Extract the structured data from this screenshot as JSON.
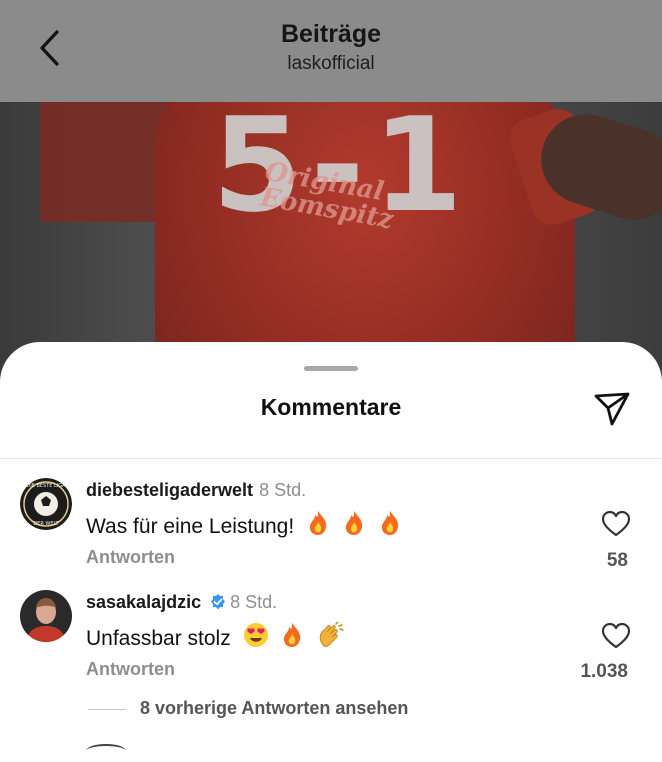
{
  "header": {
    "title": "Beiträge",
    "subtitle": "laskofficial"
  },
  "post": {
    "score_text": "5-1",
    "sponsor_text": "Original\nEomspitz"
  },
  "sheet": {
    "title": "Kommentare"
  },
  "comments": [
    {
      "username": "diebesteligaderwelt",
      "time": "8 Std.",
      "text": "Was für eine Leistung!",
      "emojis": [
        "fire",
        "fire",
        "fire"
      ],
      "reply_label": "Antworten",
      "likes": "58",
      "verified": false,
      "avatar_logo_text": "DIE BESTE LIGA DER WELT"
    },
    {
      "username": "sasakalajdzic",
      "time": "8 Std.",
      "text": "Unfassbar stolz",
      "emojis": [
        "heart-eyes",
        "fire",
        "clapping"
      ],
      "reply_label": "Antworten",
      "likes": "1.038",
      "verified": true
    }
  ],
  "view_replies_label": "8 vorherige Antworten ansehen",
  "colors": {
    "accent_verified": "#3797f0",
    "muted_text": "#8e8e8e",
    "header_bg": "#8b8b8b"
  }
}
